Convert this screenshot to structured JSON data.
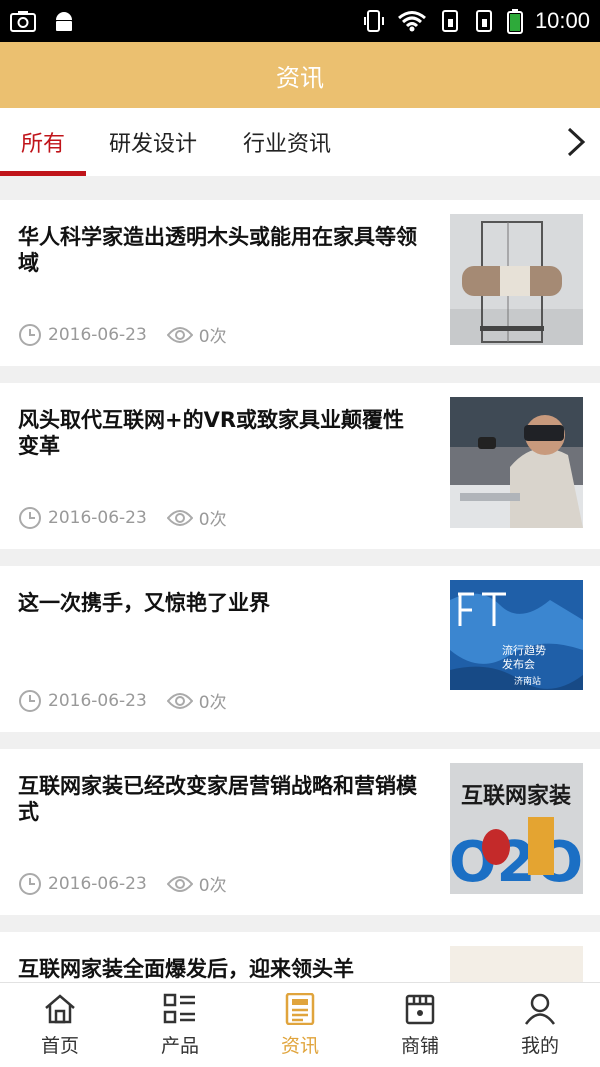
{
  "status": {
    "time": "10:00"
  },
  "header": {
    "title": "资讯"
  },
  "tabs": [
    {
      "label": "所有",
      "active": true
    },
    {
      "label": "研发设计",
      "active": false
    },
    {
      "label": "行业资讯",
      "active": false
    }
  ],
  "articles": [
    {
      "title": "华人科学家造出透明木头或能用在家具等领域",
      "date": "2016-06-23",
      "views": "0次",
      "image": "transparent-wood-photo"
    },
    {
      "title": "风头取代互联网+的VR或致家具业颠覆性变革",
      "date": "2016-06-23",
      "views": "0次",
      "image": "vr-headset-photo"
    },
    {
      "title": "这一次携手，又惊艳了业界",
      "date": "2016-06-23",
      "views": "0次",
      "image": "ft-poster"
    },
    {
      "title": "互联网家装已经改变家居营销战略和营销模式",
      "date": "2016-06-23",
      "views": "0次",
      "image": "o2o-poster"
    },
    {
      "title": "互联网家装全面爆发后，迎来领头羊",
      "date": "",
      "views": "",
      "image": "partial-photo"
    }
  ],
  "thumb_text": {
    "ft_poster": {
      "line1": "流行趋势",
      "line2": "发布会",
      "line3": "济南站"
    },
    "o2o_poster": {
      "heading": "互联网家装",
      "code": "O2O"
    }
  },
  "tabbar": [
    {
      "label": "首页",
      "icon": "home-icon",
      "active": false
    },
    {
      "label": "产品",
      "icon": "list-icon",
      "active": false
    },
    {
      "label": "资讯",
      "icon": "news-icon",
      "active": true
    },
    {
      "label": "商铺",
      "icon": "store-icon",
      "active": false
    },
    {
      "label": "我的",
      "icon": "user-icon",
      "active": false
    }
  ],
  "colors": {
    "brand": "#ebc070",
    "active_tab": "#c0141a",
    "active_nav": "#e0a43c"
  }
}
